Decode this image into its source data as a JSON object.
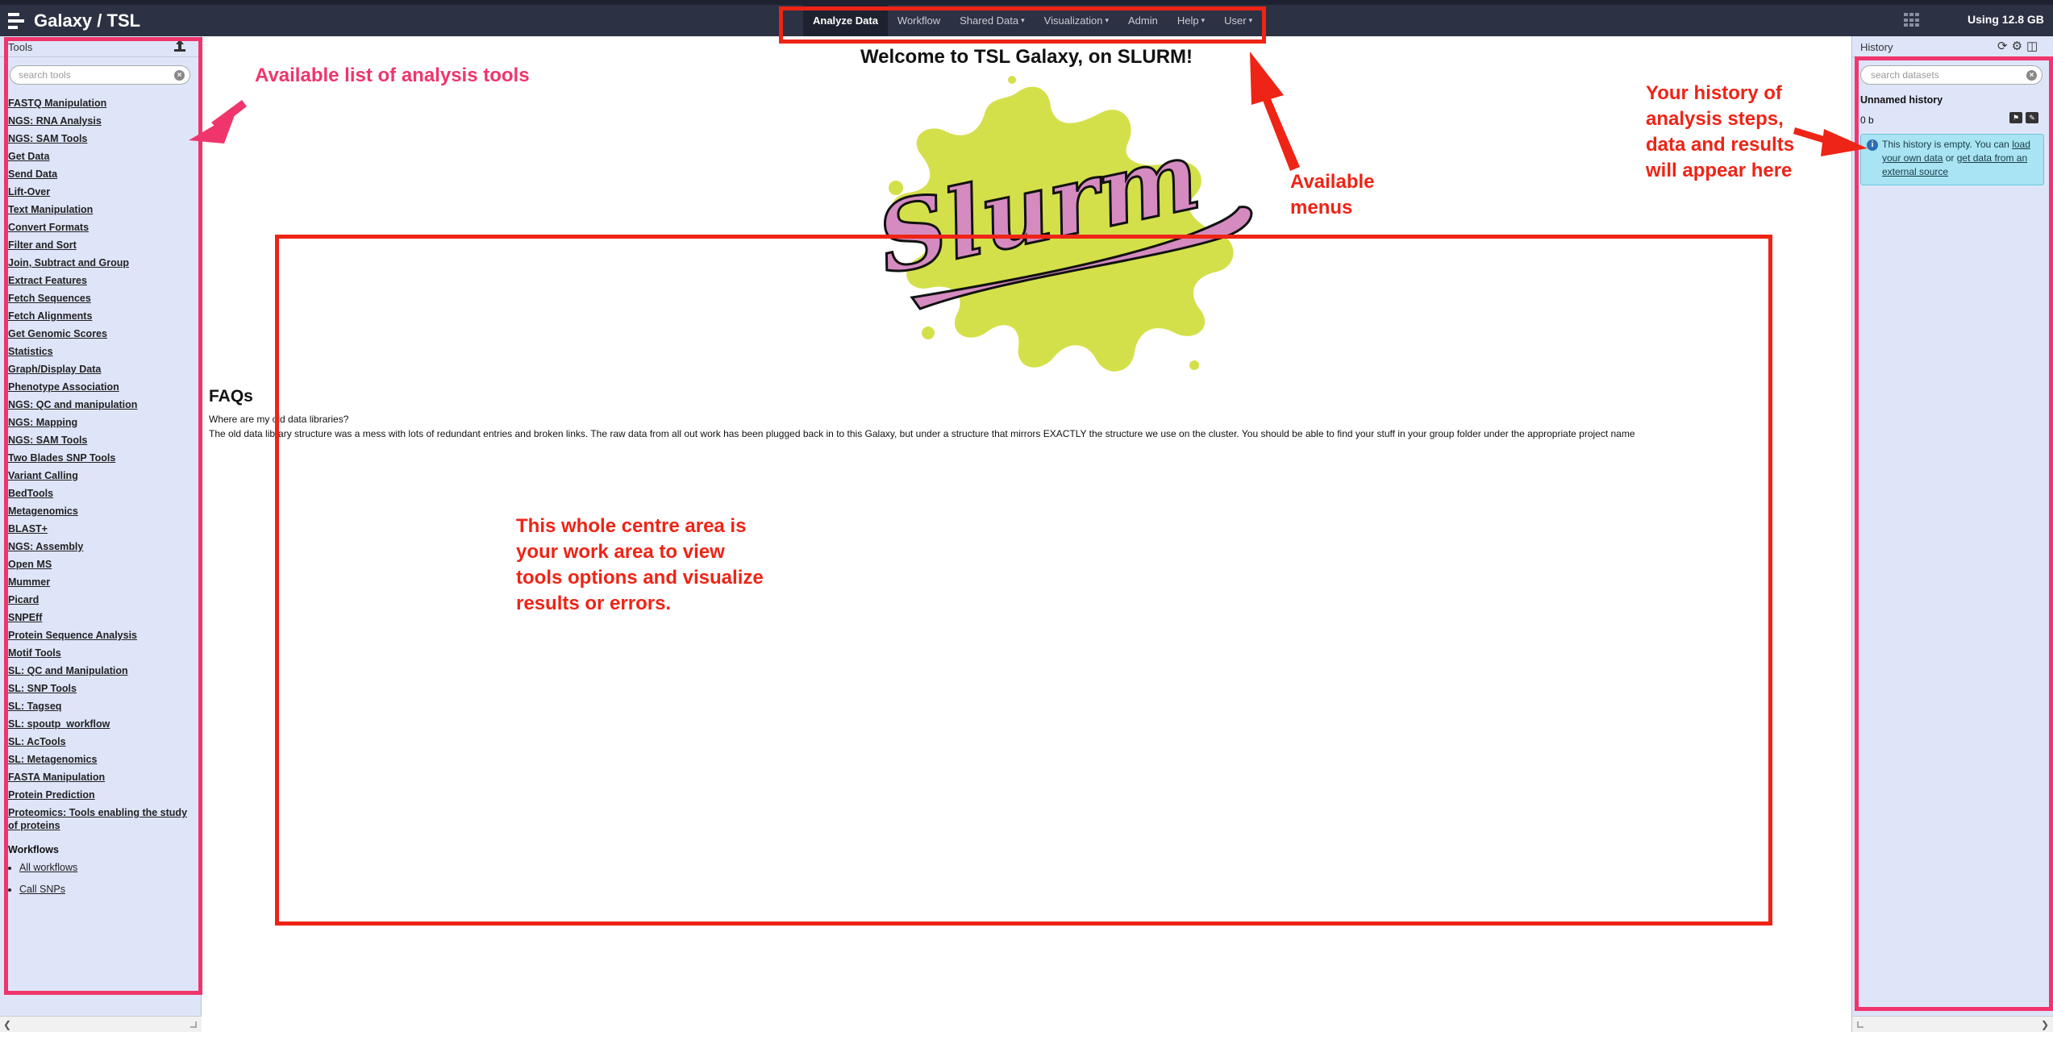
{
  "masthead": {
    "brand": "Galaxy / TSL",
    "nav": [
      {
        "label": "Analyze Data",
        "active": true,
        "dropdown": false
      },
      {
        "label": "Workflow",
        "active": false,
        "dropdown": false
      },
      {
        "label": "Shared Data",
        "active": false,
        "dropdown": true
      },
      {
        "label": "Visualization",
        "active": false,
        "dropdown": true
      },
      {
        "label": "Admin",
        "active": false,
        "dropdown": false
      },
      {
        "label": "Help",
        "active": false,
        "dropdown": true
      },
      {
        "label": "User",
        "active": false,
        "dropdown": true
      }
    ],
    "quota": "Using 12.8 GB"
  },
  "tools_panel": {
    "title": "Tools",
    "search_placeholder": "search tools",
    "sections": [
      "FASTQ Manipulation",
      "NGS: RNA Analysis",
      "NGS: SAM Tools",
      "Get Data",
      "Send Data",
      "Lift-Over",
      "Text Manipulation",
      "Convert Formats",
      "Filter and Sort",
      "Join, Subtract and Group",
      "Extract Features",
      "Fetch Sequences",
      "Fetch Alignments",
      "Get Genomic Scores",
      "Statistics",
      "Graph/Display Data",
      "Phenotype Association",
      "NGS: QC and manipulation",
      "NGS: Mapping",
      "NGS: SAM Tools",
      "Two Blades SNP Tools",
      "Variant Calling",
      "BedTools",
      "Metagenomics",
      "BLAST+",
      "NGS: Assembly",
      "Open MS",
      "Mummer",
      "Picard",
      "SNPEff",
      "Protein Sequence Analysis",
      "Motif Tools",
      "SL: QC and Manipulation",
      "SL: SNP Tools",
      "SL: Tagseq",
      "SL: spoutp_workflow",
      "SL: AcTools",
      "SL: Metagenomics",
      "FASTA Manipulation",
      "Protein Prediction",
      "Proteomics: Tools enabling the study of proteins"
    ],
    "workflows_title": "Workflows",
    "workflows": [
      "All workflows",
      "Call SNPs"
    ]
  },
  "center": {
    "welcome": "Welcome to TSL Galaxy, on SLURM!",
    "logo_text": "Slurm",
    "faq_title": "FAQs",
    "faq_question": "Where are my old data libraries?",
    "faq_answer": "The old data library structure was a mess with lots of redundant entries and broken links. The raw data from all out work has been plugged back in to this Galaxy, but under a structure that mirrors EXACTLY the structure we use on the cluster. You should be able to find your stuff in your group folder under the appropriate project name"
  },
  "history_panel": {
    "title": "History",
    "search_placeholder": "search datasets",
    "history_name": "Unnamed history",
    "size": "0 b",
    "empty_prefix": "This history is empty. You can ",
    "empty_link1": "load your own data",
    "empty_mid": " or ",
    "empty_link2": "get data from an external source"
  },
  "annotations": {
    "tools": "Available list of analysis tools",
    "menus_line1": "Available",
    "menus_line2": "menus",
    "history_line1": "Your history of",
    "history_line2": "analysis steps,",
    "history_line3": "data and results",
    "history_line4": "will appear here",
    "center_line1": "This whole centre area is",
    "center_line2": "your work area to view",
    "center_line3": "tools options and visualize",
    "center_line4": "results or errors."
  },
  "colors": {
    "masthead": "#2c3143",
    "panel_bg": "#dfe5f9",
    "annotation_red": "#ee2416",
    "annotation_pink": "#f0356c",
    "logo_splash": "#d4e04a",
    "logo_text": "#d58bc0"
  }
}
